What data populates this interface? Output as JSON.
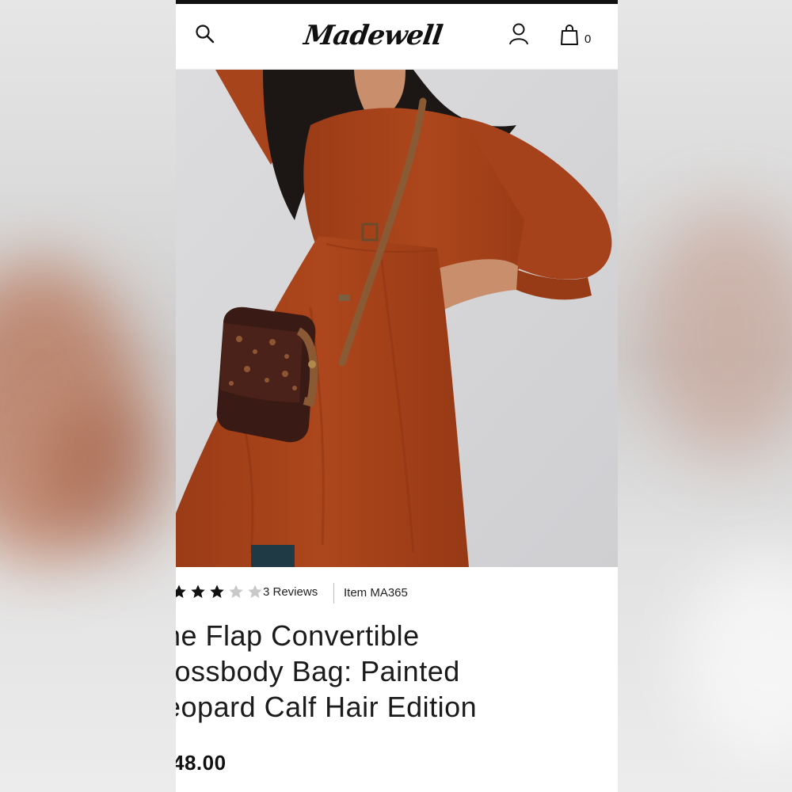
{
  "brand": {
    "name": "Madewell"
  },
  "header": {
    "search_icon": "search-icon",
    "account_icon": "account-icon",
    "bag_icon": "shopping-bag-icon",
    "bag_count": "0"
  },
  "product": {
    "rating": 3,
    "rating_max": 5,
    "reviews_label": "3 Reviews",
    "item_label": "Item MA365",
    "title_lines": [
      "he Flap Convertible",
      "rossbody Bag: Painted",
      "eopard Calf Hair Edition"
    ],
    "price": "48.00"
  },
  "colors": {
    "dress": "#a9431b",
    "bag": "#3a1a14",
    "strap": "#8a5a35",
    "hero_bg": "#d6d6d8",
    "star_filled": "#111111",
    "star_empty": "#c8c8c8"
  }
}
